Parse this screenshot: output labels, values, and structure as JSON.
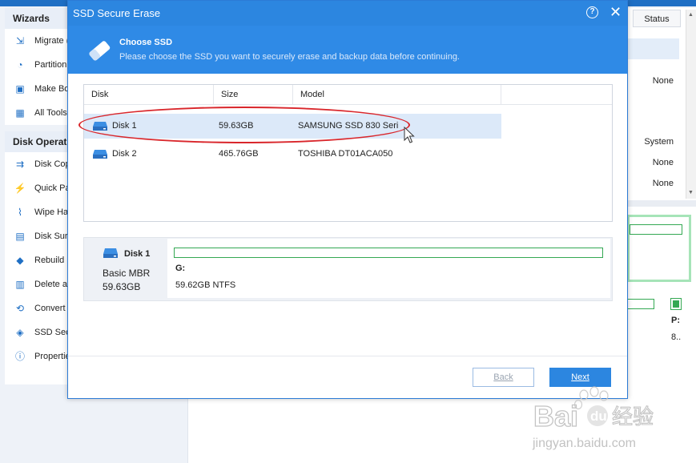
{
  "background": {
    "sidebar": {
      "sections": [
        {
          "title": "Wizards",
          "items": [
            {
              "label": "Migrate (",
              "icon": "migrate-icon"
            },
            {
              "label": "Partition",
              "icon": "partition-icon"
            },
            {
              "label": "Make Bo",
              "icon": "make-bootable-icon"
            },
            {
              "label": "All Tools",
              "icon": "all-tools-icon"
            }
          ]
        },
        {
          "title": "Disk Operati",
          "items": [
            {
              "label": "Disk Cop",
              "icon": "disk-copy-icon"
            },
            {
              "label": "Quick Pa",
              "icon": "lightning-icon"
            },
            {
              "label": "Wipe Ha",
              "icon": "broom-icon"
            },
            {
              "label": "Disk Surf",
              "icon": "surface-test-icon"
            },
            {
              "label": "Rebuild M",
              "icon": "tag-icon"
            },
            {
              "label": "Delete a",
              "icon": "trash-icon"
            },
            {
              "label": "Convert",
              "icon": "convert-icon"
            },
            {
              "label": "SSD Secu",
              "icon": "eraser-icon"
            },
            {
              "label": "Propertie",
              "icon": "info-icon"
            }
          ]
        }
      ]
    },
    "status_header": "Status",
    "status_values": [
      "None",
      "System",
      "None",
      "None"
    ],
    "right_card": {
      "letter": "P:",
      "size": "8.."
    }
  },
  "dialog": {
    "title": "SSD Secure Erase",
    "help_label": "?",
    "close_label": "✕",
    "header": {
      "icon": "eraser-icon",
      "title": "Choose SSD",
      "subtitle": "Please choose the SSD you want to securely erase and backup data before continuing."
    },
    "table": {
      "columns": [
        "Disk",
        "Size",
        "Model"
      ],
      "rows": [
        {
          "disk": "Disk 1",
          "size": "59.63GB",
          "model": "SAMSUNG SSD 830 Seri",
          "selected": true
        },
        {
          "disk": "Disk 2",
          "size": "465.76GB",
          "model": "TOSHIBA DT01ACA050",
          "selected": false
        }
      ]
    },
    "disk_map": {
      "disk_name": "Disk 1",
      "disk_type": "Basic MBR",
      "disk_size": "59.63GB",
      "partition_letter": "G:",
      "partition_info": "59.62GB NTFS"
    },
    "buttons": {
      "back": "Back",
      "next": "Next"
    }
  },
  "watermark": {
    "text": "Baidu经验",
    "url_text": "jingyan.baidu.com"
  },
  "colors": {
    "accent": "#2c86e0",
    "header_bg": "#2f8ae6",
    "selection": "#dce9f9",
    "partition_border": "#34a853",
    "annotation": "#d9262b"
  }
}
